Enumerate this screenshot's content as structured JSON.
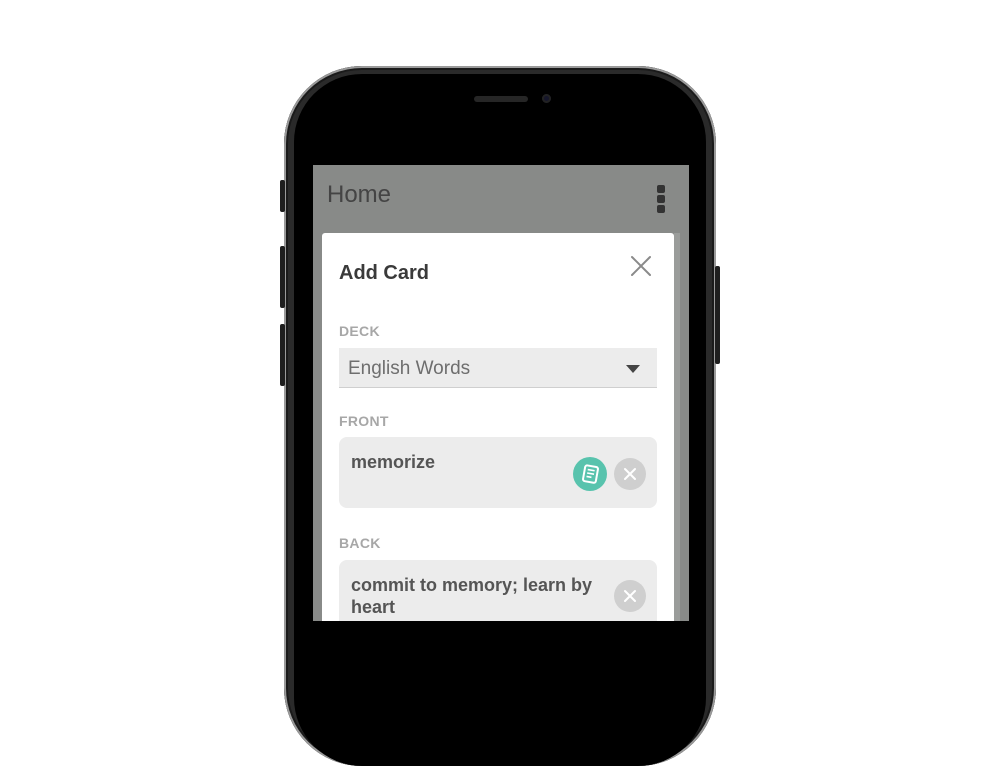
{
  "header": {
    "title": "Home",
    "menu_icon": "more-vertical-icon"
  },
  "dialog": {
    "title": "Add Card",
    "close_icon": "close-icon",
    "deck": {
      "label": "DECK",
      "selected": "English Words",
      "dropdown_icon": "caret-down-icon"
    },
    "front": {
      "label": "FRONT",
      "value": "memorize",
      "dictionary_icon": "book-icon",
      "clear_icon": "clear-icon"
    },
    "back": {
      "label": "BACK",
      "value": "commit to memory; learn by heart",
      "clear_icon": "clear-icon"
    }
  },
  "colors": {
    "accent": "#58c3ad",
    "overlay": "#888a88",
    "field_bg": "#ececec"
  }
}
